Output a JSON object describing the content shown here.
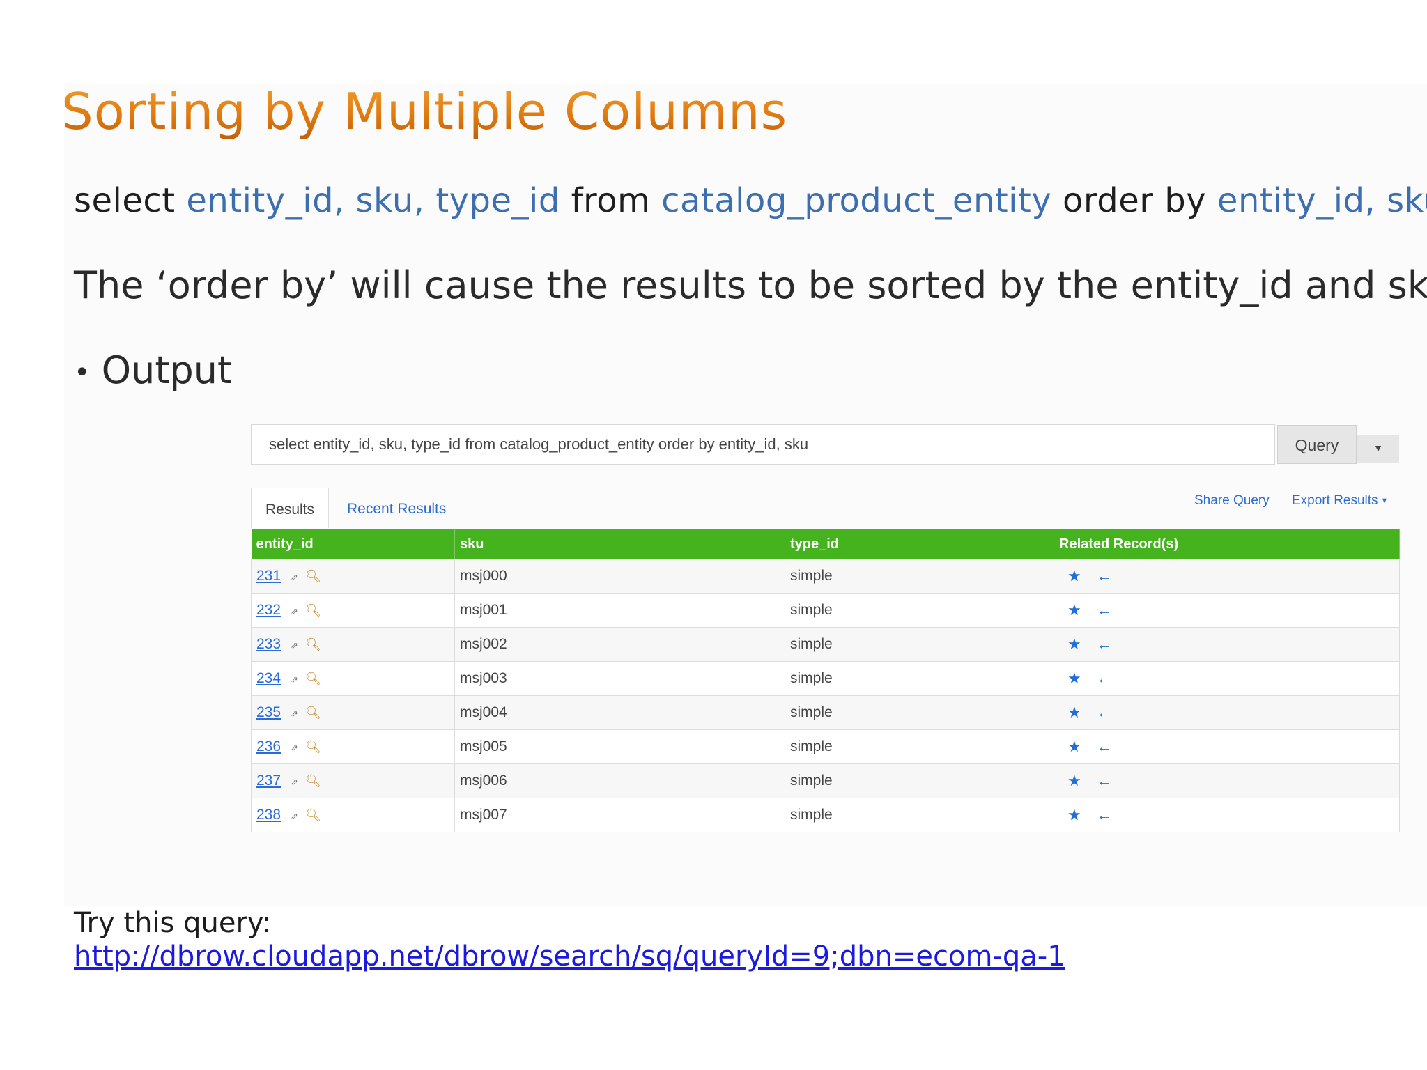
{
  "slide": {
    "title": "Sorting by Multiple Columns",
    "sql": {
      "select": "select",
      "cols": "entity_id, sku, type_id",
      "from": "from",
      "table": "catalog_product_entity",
      "order": "order by",
      "order_cols": "entity_id, sku"
    },
    "description": "The ‘order by’ will cause the results to be sorted by the entity_id and sku",
    "bullet": "Output",
    "try_label": "Try this query:",
    "try_link": "http://dbrow.cloudapp.net/dbrow/search/sq/queryId=9;dbn=ecom-qa-1"
  },
  "app": {
    "query_text": "select entity_id, sku, type_id from catalog_product_entity order by entity_id, sku",
    "query_button": "Query",
    "tabs": {
      "results": "Results",
      "recent": "Recent Results"
    },
    "actions": {
      "share": "Share Query",
      "export": "Export Results"
    },
    "columns": [
      "entity_id",
      "sku",
      "type_id",
      "Related Record(s)"
    ],
    "rows": [
      {
        "entity_id": "231",
        "sku": "msj000",
        "type_id": "simple"
      },
      {
        "entity_id": "232",
        "sku": "msj001",
        "type_id": "simple"
      },
      {
        "entity_id": "233",
        "sku": "msj002",
        "type_id": "simple"
      },
      {
        "entity_id": "234",
        "sku": "msj003",
        "type_id": "simple"
      },
      {
        "entity_id": "235",
        "sku": "msj004",
        "type_id": "simple"
      },
      {
        "entity_id": "236",
        "sku": "msj005",
        "type_id": "simple"
      },
      {
        "entity_id": "237",
        "sku": "msj006",
        "type_id": "simple"
      },
      {
        "entity_id": "238",
        "sku": "msj007",
        "type_id": "simple"
      }
    ],
    "icons": {
      "open": "external-link-icon",
      "inspect": "magnifier-icon",
      "favorite": "star-icon",
      "related": "arrow-left-icon"
    },
    "colors": {
      "header_green": "#44b31e",
      "link_blue": "#2a6bd6",
      "title_orange": "#e07b10",
      "sql_blue": "#3d6fb0"
    }
  }
}
